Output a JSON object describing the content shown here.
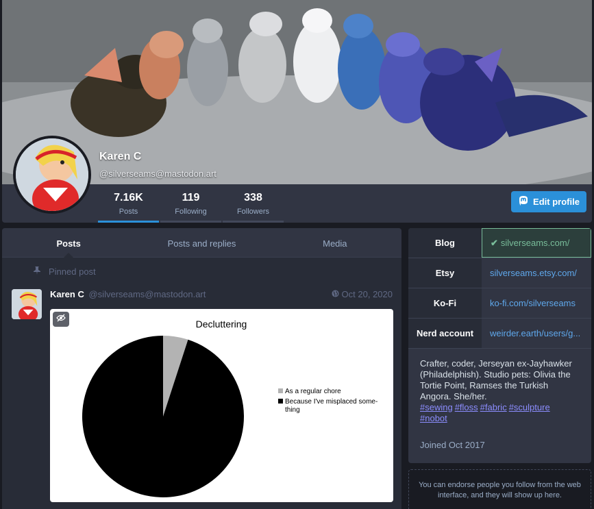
{
  "profile": {
    "display_name": "Karen C",
    "handle": "@silverseams@mastodon.art",
    "edit_button": "Edit profile"
  },
  "counters": [
    {
      "num": "7.16K",
      "label": "Posts"
    },
    {
      "num": "119",
      "label": "Following"
    },
    {
      "num": "338",
      "label": "Followers"
    }
  ],
  "tabs": [
    "Posts",
    "Posts and replies",
    "Media"
  ],
  "pinned_label": "Pinned post",
  "status": {
    "display_name": "Karen C",
    "acct": "@silverseams@mastodon.art",
    "time": "Oct 20, 2020",
    "visibility_icon": "globe-icon",
    "chart_data": {
      "type": "pie",
      "title": "Decluttering",
      "series": [
        {
          "name": "As a regular chore",
          "value": 5,
          "color": "#b3b3b3"
        },
        {
          "name": "Because I've misplaced some-thing",
          "value": 95,
          "color": "#000000"
        }
      ],
      "legend_lines": [
        [
          "As a regular chore"
        ],
        [
          "Because I've misplaced some-",
          "thing"
        ]
      ],
      "legend_position": "right"
    }
  },
  "fields": [
    {
      "name": "Blog",
      "value": "silverseams.com/",
      "verified": true
    },
    {
      "name": "Etsy",
      "value": "silverseams.etsy.com/",
      "verified": false
    },
    {
      "name": "Ko-Fi",
      "value": "ko-fi.com/silverseams",
      "verified": false
    },
    {
      "name": "Nerd account",
      "value": "weirder.earth/users/g...",
      "verified": false
    }
  ],
  "bio": {
    "text": "Crafter, coder, Jerseyan ex-Jayhawker (Philadelphish). Studio pets: Olivia the Tortie Point, Ramses the Turkish Angora. She/her.",
    "tags": [
      "#sewing",
      "#floss",
      "#fabric",
      "#sculpture",
      "#nobot"
    ]
  },
  "joined": "Joined Oct 2017",
  "endorse_text": "You can endorse people you follow from the web interface, and they will show up here.",
  "colors": {
    "accent": "#2b90d9",
    "verified": "#79bd9a",
    "background": "#191b22",
    "panel": "#282c37"
  }
}
